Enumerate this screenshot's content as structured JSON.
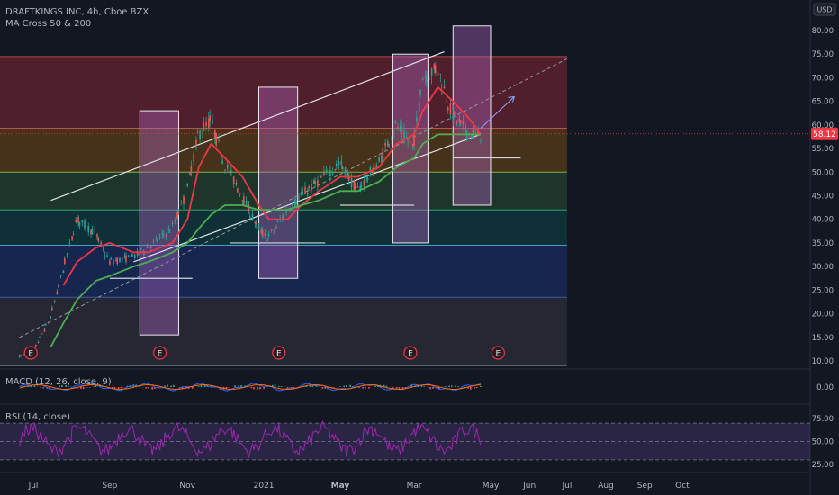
{
  "header": {
    "symbol_line": "DRAFTKINGS INC, 4h, Cboe BZX",
    "indicator": "MA Cross 50 & 200",
    "currency": "USD"
  },
  "price_axis": {
    "ticks": [
      "80.00",
      "75.00",
      "70.00",
      "65.00",
      "60.00",
      "55.00",
      "50.00",
      "45.00",
      "40.00",
      "35.00",
      "30.00",
      "25.00",
      "20.00",
      "15.00",
      "10.00"
    ],
    "last_price": "58.12",
    "last_price_color": "#f23645"
  },
  "macd_panel": {
    "label": "MACD (12, 26, close, 9)",
    "ticks": [
      "0.00"
    ]
  },
  "rsi_panel": {
    "label": "RSI (14, close)",
    "ticks": [
      "75.00",
      "50.00",
      "25.00"
    ]
  },
  "time_axis": {
    "labels": [
      "May",
      "Jul",
      "Sep",
      "Nov",
      "2021",
      "Mar",
      "May",
      "Jun",
      "Jul",
      "Aug",
      "Sep",
      "Oct"
    ]
  },
  "earnings_marker": "E",
  "colors": {
    "background": "#131722",
    "candle": "#26a69a",
    "ma_fast": "#f23645",
    "ma_slow": "#4caf50",
    "rsi": "#9c27b0",
    "box_fill": "#b667c8",
    "macd_line": "#2962ff",
    "signal_line": "#ff6d00"
  },
  "chart_data": {
    "type": "line",
    "title": "DRAFTKINGS INC, 4h, Cboe BZX",
    "x": [
      "2020-04-20",
      "2020-05-01",
      "2020-05-15",
      "2020-05-25",
      "2020-06-05",
      "2020-06-20",
      "2020-07-01",
      "2020-07-20",
      "2020-08-01",
      "2020-08-20",
      "2020-09-01",
      "2020-09-10",
      "2020-09-20",
      "2020-10-01",
      "2020-10-15",
      "2020-10-28",
      "2020-11-05",
      "2020-11-20",
      "2020-12-01",
      "2020-12-15",
      "2021-01-01",
      "2021-01-15",
      "2021-02-01",
      "2021-02-15",
      "2021-03-01",
      "2021-03-08",
      "2021-03-20",
      "2021-04-01",
      "2021-04-15",
      "2021-04-23"
    ],
    "series": [
      {
        "values": [
          11,
          12,
          19,
          29,
          40,
          37,
          31,
          32,
          34,
          38,
          46,
          58,
          61,
          52,
          45,
          38,
          36,
          42,
          45,
          48,
          52,
          46,
          52,
          60,
          55,
          70,
          72,
          62,
          58,
          58.1
        ]
      },
      {
        "values": [
          null,
          null,
          null,
          26,
          31,
          34,
          35,
          33,
          33,
          35,
          40,
          51,
          56,
          53,
          49,
          43,
          40,
          40,
          43,
          46,
          49,
          49,
          51,
          56,
          58,
          63,
          68,
          65,
          61,
          58
        ]
      },
      {
        "values": [
          null,
          null,
          13,
          18,
          23,
          27,
          28,
          30,
          31,
          33,
          35,
          38,
          41,
          43,
          43,
          42,
          42,
          42,
          43,
          44,
          46,
          46,
          48,
          51,
          53,
          56,
          58,
          58,
          58,
          58
        ]
      }
    ],
    "ylim": [
      10,
      85
    ],
    "fib_levels": [
      74.5,
      59.3,
      50,
      42,
      34.5,
      23.5,
      9
    ],
    "channel": {
      "lower": [
        [
          "2020-07-20",
          31
        ],
        [
          "2021-04-23",
          58
        ]
      ],
      "upper": [
        [
          "2020-05-15",
          44
        ],
        [
          "2021-03-25",
          75.5
        ]
      ]
    },
    "projection": [
      [
        "2020-04-20",
        15
      ],
      [
        "2021-07-01",
        74
      ]
    ],
    "support_lines": [
      [
        "2020-07-01",
        "2020-09-05",
        27.5
      ],
      [
        "2020-10-05",
        "2020-12-20",
        35
      ],
      [
        "2021-01-01",
        "2021-03-01",
        43
      ],
      [
        "2021-04-01",
        "2021-05-25",
        53
      ]
    ],
    "earnings_boxes": [
      [
        [
          "2020-07-25",
          "2020-08-25"
        ],
        [
          15.5,
          63
        ]
      ],
      [
        [
          "2020-10-28",
          "2020-11-28"
        ],
        [
          27.5,
          68
        ]
      ],
      [
        [
          "2021-02-12",
          "2021-03-12"
        ],
        [
          35,
          75
        ]
      ],
      [
        [
          "2021-04-01",
          "2021-05-01"
        ],
        [
          43,
          81
        ]
      ]
    ],
    "earnings_dates": [
      "2020-04-29",
      "2020-08-10",
      "2020-11-13",
      "2021-02-26",
      "2021-05-07"
    ],
    "time_labels": {
      "May": "2020-05-01",
      "Jul": "2020-07-01",
      "Sep": "2020-09-01",
      "Nov": "2020-11-01",
      "2021": "2021-01-01",
      "Mar": "2021-03-01",
      "May2": "2021-05-01",
      "Jun": "2021-06-01",
      "Jul2": "2021-07-01",
      "Aug": "2021-08-01",
      "Sep2": "2021-09-01",
      "Oct": "2021-10-01"
    },
    "macd_range": [
      -2,
      2
    ],
    "rsi_ylim": [
      20,
      80
    ],
    "rsi_band": [
      30,
      70
    ]
  }
}
